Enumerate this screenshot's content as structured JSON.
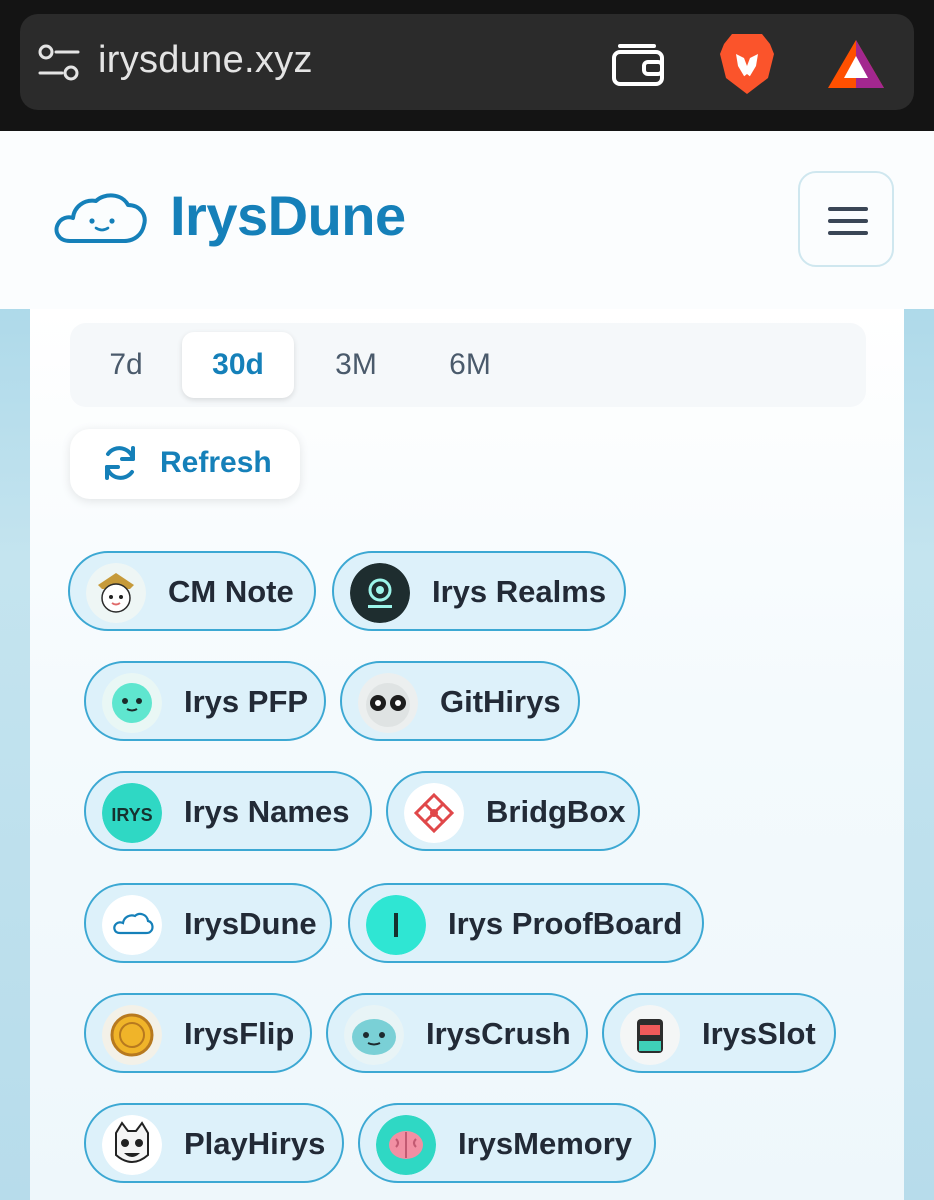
{
  "browser": {
    "url": "irysdune.xyz",
    "icons": [
      "site-settings-icon",
      "wallet-icon",
      "brave-shields-icon",
      "brave-rewards-icon"
    ]
  },
  "header": {
    "title": "IrysDune",
    "logo_icon": "cloud-icon",
    "menu_icon": "hamburger-menu-icon"
  },
  "period_tabs": {
    "items": [
      "7d",
      "30d",
      "3M",
      "6M"
    ],
    "selected": "30d"
  },
  "refresh": {
    "label": "Refresh",
    "icon": "refresh-icon"
  },
  "apps": [
    {
      "label": "CM Note",
      "avatar": "samurai-avatar-icon"
    },
    {
      "label": "Irys Realms",
      "avatar": "irys-realms-logo-icon"
    },
    {
      "label": "Irys PFP",
      "avatar": "pfp-face-icon"
    },
    {
      "label": "GitHirys",
      "avatar": "githirys-face-icon"
    },
    {
      "label": "Irys Names",
      "avatar": "irys-names-logo-icon"
    },
    {
      "label": "BridgBox",
      "avatar": "bridgbox-logo-icon"
    },
    {
      "label": "IrysDune",
      "avatar": "cloud-icon"
    },
    {
      "label": "Irys ProofBoard",
      "avatar": "proofboard-logo-icon"
    },
    {
      "label": "IrysFlip",
      "avatar": "coin-icon"
    },
    {
      "label": "IrysCrush",
      "avatar": "crush-face-icon"
    },
    {
      "label": "IrysSlot",
      "avatar": "slot-machine-icon"
    },
    {
      "label": "PlayHirys",
      "avatar": "playhirys-face-icon"
    },
    {
      "label": "IrysMemory",
      "avatar": "brain-icon"
    }
  ],
  "colors": {
    "brand": "#1580b9",
    "chip_border": "#3ca8d3",
    "chip_bg": "#ddf1fa",
    "irys_mint": "#2fe6d3"
  }
}
